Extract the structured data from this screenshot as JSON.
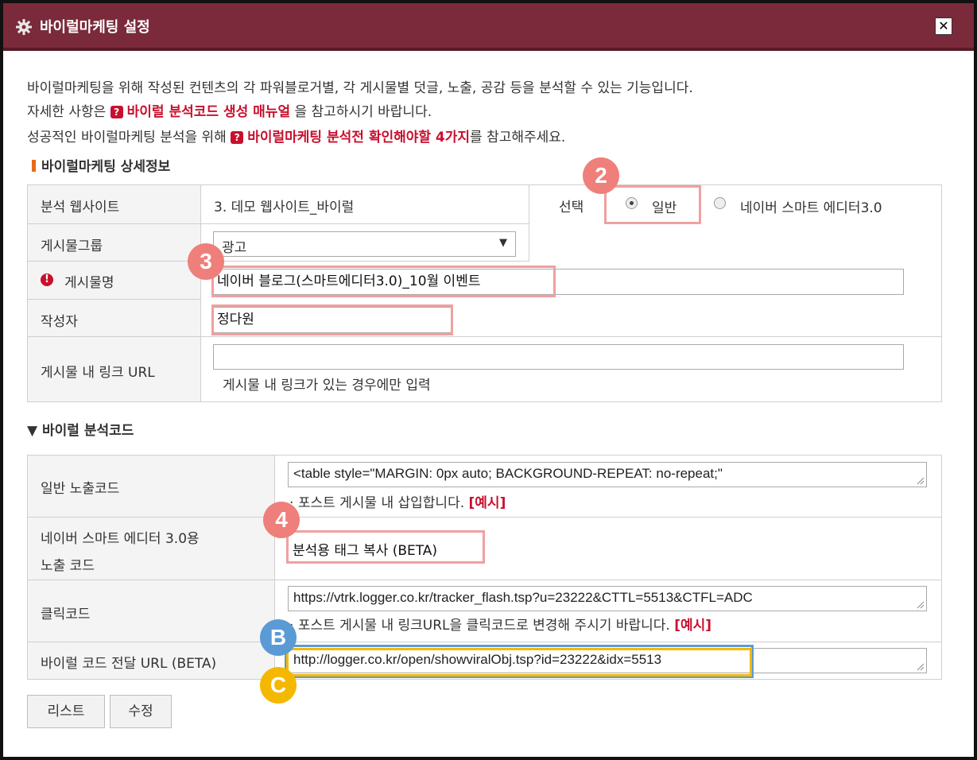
{
  "window": {
    "title": "바이럴마케팅 설정",
    "close_label": "✕"
  },
  "intro": {
    "line1": "바이럴마케팅을 위해 작성된 컨텐츠의 각 파워블로거별, 각 게시물별 덧글, 노출, 공감 등을 분석할 수 있는 기능입니다.",
    "line2_pre": "자세한 사항은 ",
    "line2_link": "바이럴 분석코드 생성 매뉴얼",
    "line2_post": " 을 참고하시기 바랍니다.",
    "line3_pre": "성공적인 바이럴마케팅 분석을 위해 ",
    "line3_link": "바이럴마케팅 분석전 확인해야할 4가지",
    "line3_post": "를 참고해주세요.",
    "help_icon": "?"
  },
  "detail": {
    "section_title": "바이럴마케팅 상세정보",
    "website_label": "분석 웹사이트",
    "website_value": "3. 데모 웹사이트_바이럴",
    "select_label": "선택",
    "radio_general": "일반",
    "radio_naver": "네이버 스마트 에디터3.0",
    "group_label": "게시물그룹",
    "group_value": "광고",
    "post_name_label": "게시물명",
    "post_name_value": "네이버 블로그(스마트에디터3.0)_10월 이벤트",
    "author_label": "작성자",
    "author_value": "정다원",
    "link_label": "게시물 내 링크 URL",
    "link_value": "",
    "link_hint": "게시물 내 링크가 있는 경우에만 입력"
  },
  "code": {
    "section_title": "▼ 바이럴 분석코드",
    "general_label": "일반 노출코드",
    "general_value": "<table style=\"MARGIN: 0px auto; BACKGROUND-REPEAT: no-repeat;\"",
    "general_hint": "포스트 게시물 내 삽입합니다.",
    "example_label": "[예시]",
    "naver_label_1": "네이버 스마트 에디터 3.0용",
    "naver_label_2": "노출 코드",
    "naver_value": "분석용 태그 복사 (BETA)",
    "click_label": "클릭코드",
    "click_value": "https://vtrk.logger.co.kr/tracker_flash.tsp?u=23222&CTTL=5513&CTFL=ADC",
    "click_hint": "포스트 게시물 내 링크URL을 클릭코드로 변경해 주시기 바랍니다.",
    "viral_url_label": "바이럴 코드 전달 URL (BETA)",
    "viral_url_value": "http://logger.co.kr/open/showviralObj.tsp?id=23222&idx=5513"
  },
  "buttons": {
    "list": "리스트",
    "edit": "수정"
  },
  "callouts": {
    "two": "2",
    "three": "3",
    "four": "4",
    "b": "B",
    "c": "C"
  },
  "colors": {
    "titlebar": "#7a2a3a",
    "link_red": "#c8102e",
    "callout_red": "#ef7f7a",
    "callout_blue": "#5b9bd5",
    "callout_yellow": "#f5b800"
  }
}
